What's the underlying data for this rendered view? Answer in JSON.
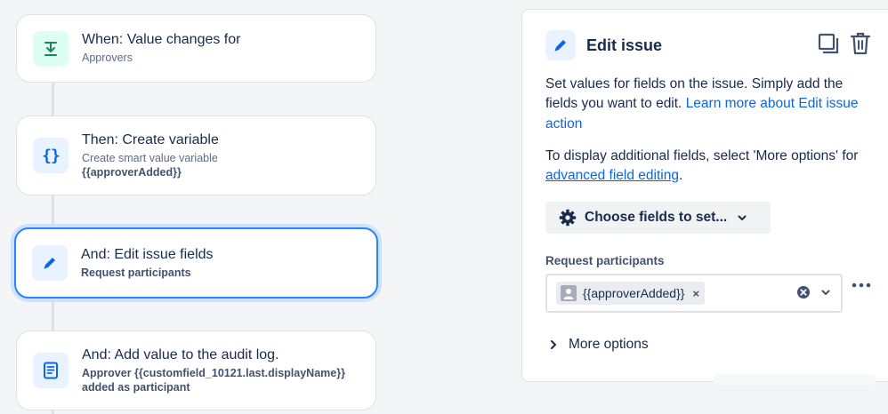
{
  "flow": {
    "trigger": {
      "title": "When: Value changes for",
      "subtitle": "Approvers",
      "icon": "download-arrow-icon"
    },
    "step_variable": {
      "title": "Then: Create variable",
      "subtitle": "Create smart value variable",
      "detail": "{{approverAdded}}",
      "icon": "curly-braces-icon"
    },
    "step_edit": {
      "title": "And: Edit issue fields",
      "subtitle": "Request participants",
      "icon": "pencil-icon"
    },
    "step_audit": {
      "title": "And: Add value to the audit log.",
      "line1": "Approver {{customfield_10121.last.displayName}}",
      "line2": "added as participant",
      "icon": "document-icon"
    }
  },
  "panel": {
    "title": "Edit issue",
    "icon": "pencil-icon",
    "description": "Set values for fields on the issue. Simply add the fields you want to edit.",
    "learn_more_link": "Learn more about Edit issue action",
    "additional_prefix": "To display additional fields, select 'More options' for",
    "advanced_link": "advanced field editing",
    "additional_suffix": ".",
    "choose_button": "Choose fields to set...",
    "field_label": "Request participants",
    "chip_value": "{{approverAdded}}",
    "chip_remove": "×",
    "more_options": "More options"
  },
  "colors": {
    "accent": "#0c66e4",
    "selected_border": "#2684ff",
    "trigger_bg": "#dcfff1",
    "action_bg": "#e9f2ff"
  }
}
